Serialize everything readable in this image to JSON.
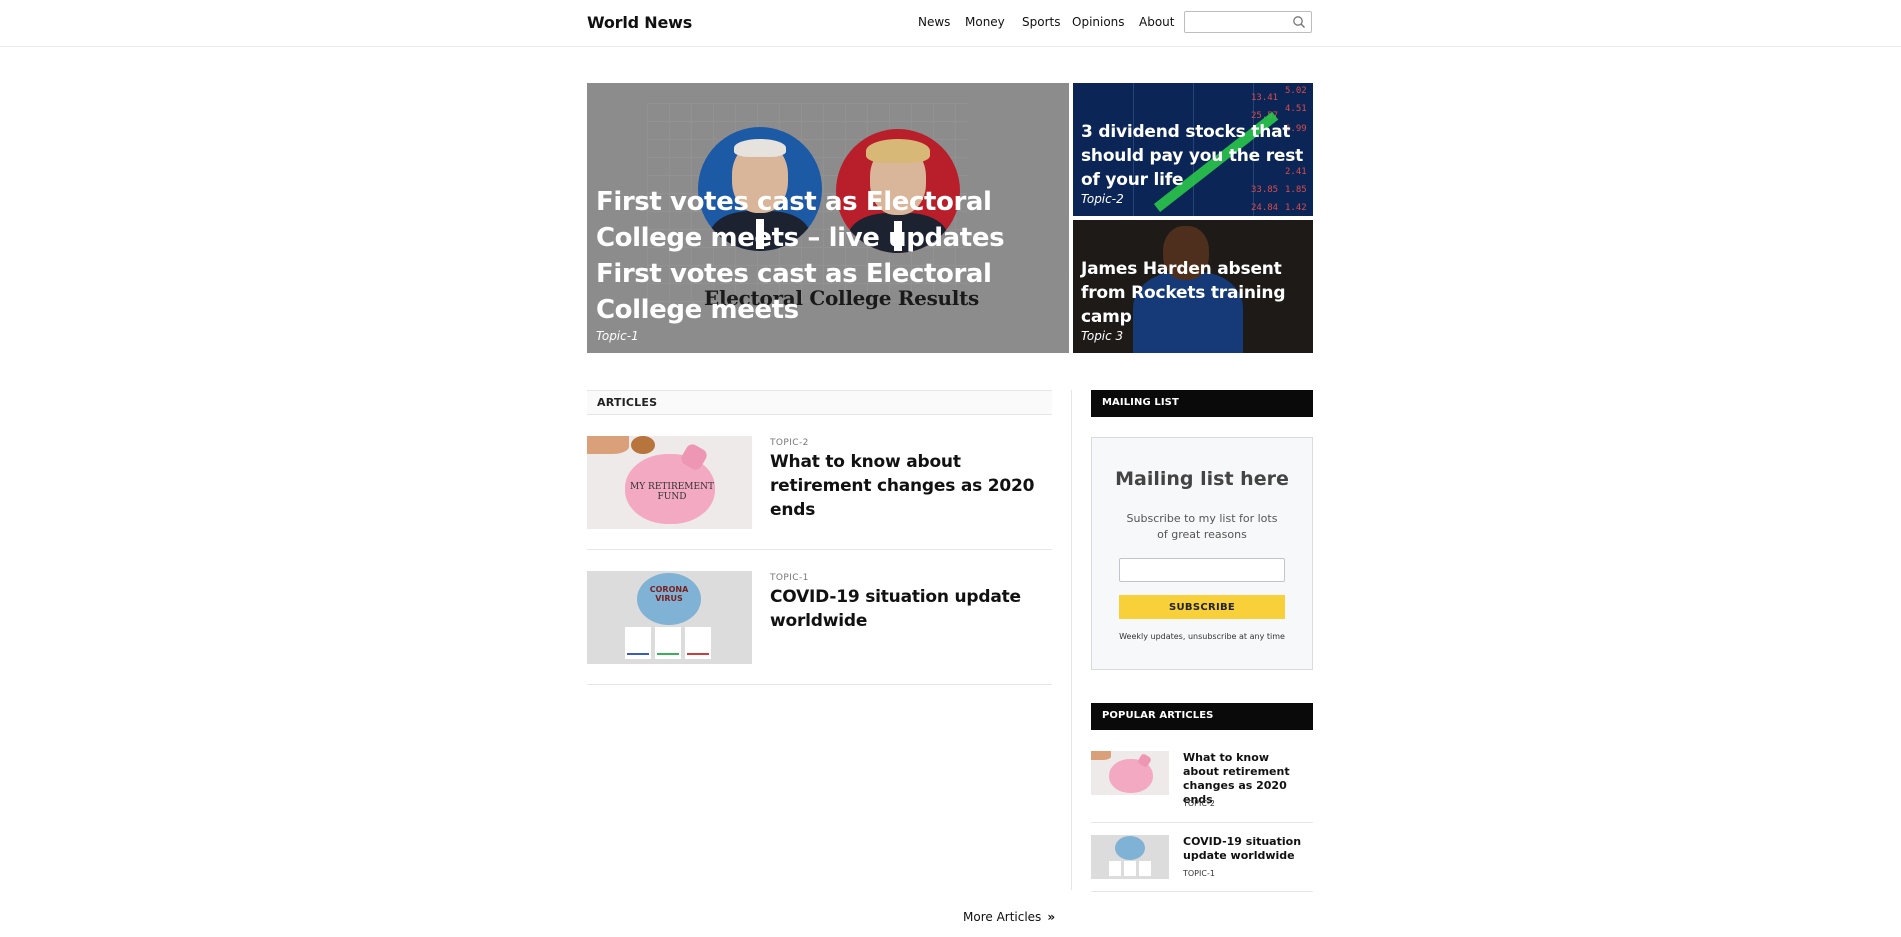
{
  "header": {
    "brand": "World News",
    "nav": [
      "News",
      "Money",
      "Sports",
      "Opinions",
      "About"
    ],
    "search_placeholder": ""
  },
  "hero": {
    "main": {
      "title": "First votes cast as Electoral College meets – live updates First votes cast as Electoral College meets",
      "topic": "Topic-1",
      "image_caption": "Electoral College Results"
    },
    "side": [
      {
        "title": "3 dividend stocks that should pay you the rest of your life",
        "topic": "Topic-2"
      },
      {
        "title": "James Harden absent from Rockets training camp",
        "topic": "Topic 3"
      }
    ]
  },
  "articles": {
    "header": "ARTICLES",
    "items": [
      {
        "topic": "TOPIC-2",
        "title": "What to know about retirement changes as 2020 ends",
        "thumb_text": "MY RETIREMENT FUND"
      },
      {
        "topic": "TOPIC-1",
        "title": "COVID-19 situation update worldwide",
        "thumb_text": "CORONA VIRUS"
      }
    ],
    "more_label": "More Articles"
  },
  "sidebar": {
    "mailing": {
      "header": "MAILING LIST",
      "title": "Mailing list here",
      "description": "Subscribe to my list for lots of great reasons",
      "input_value": "",
      "button_label": "SUBSCRIBE",
      "note": "Weekly updates, unsubscribe at any time"
    },
    "popular": {
      "header": "POPULAR ARTICLES",
      "items": [
        {
          "title": "What to know about retirement changes as 2020 ends",
          "topic": "TOPIC-2"
        },
        {
          "title": "COVID-19 situation update worldwide",
          "topic": "TOPIC-1"
        }
      ]
    }
  },
  "ticker_values": [
    "5.02",
    "4.51",
    "6.99",
    "2.41",
    "1.85",
    "1.42",
    "13.41",
    "25.57",
    "33.85",
    "24.84"
  ],
  "colors": {
    "subscribe_button": "#f7d03a",
    "side_header": "#0a0a0a",
    "hero_overlay": "#8c8c8c"
  }
}
